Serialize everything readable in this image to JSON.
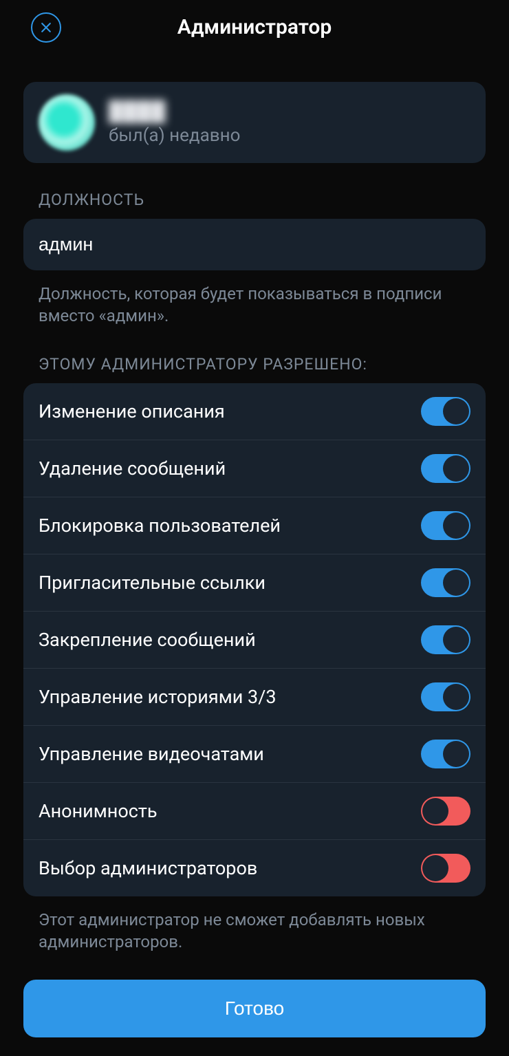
{
  "header": {
    "title": "Администратор"
  },
  "user": {
    "name": "████",
    "status": "был(а) недавно"
  },
  "roleSection": {
    "label": "ДОЛЖНОСТЬ",
    "value": "админ",
    "hint": "Должность, которая будет показываться в подписи вместо «админ»."
  },
  "permissions": {
    "label": "ЭТОМУ АДМИНИСТРАТОРУ РАЗРЕШЕНО:",
    "items": [
      {
        "label": "Изменение описания",
        "on": true
      },
      {
        "label": "Удаление сообщений",
        "on": true
      },
      {
        "label": "Блокировка пользователей",
        "on": true
      },
      {
        "label": "Пригласительные ссылки",
        "on": true
      },
      {
        "label": "Закрепление сообщений",
        "on": true
      },
      {
        "label": "Управление историями 3/3",
        "on": true
      },
      {
        "label": "Управление видеочатами",
        "on": true
      },
      {
        "label": "Анонимность",
        "on": false
      },
      {
        "label": "Выбор администраторов",
        "on": false
      }
    ],
    "hint": "Этот администратор не сможет добавлять новых администраторов."
  },
  "footer": {
    "done": "Готово"
  },
  "colors": {
    "accent": "#2f97e8",
    "offToggle": "#f25b5b",
    "cardBg": "#18222d"
  }
}
